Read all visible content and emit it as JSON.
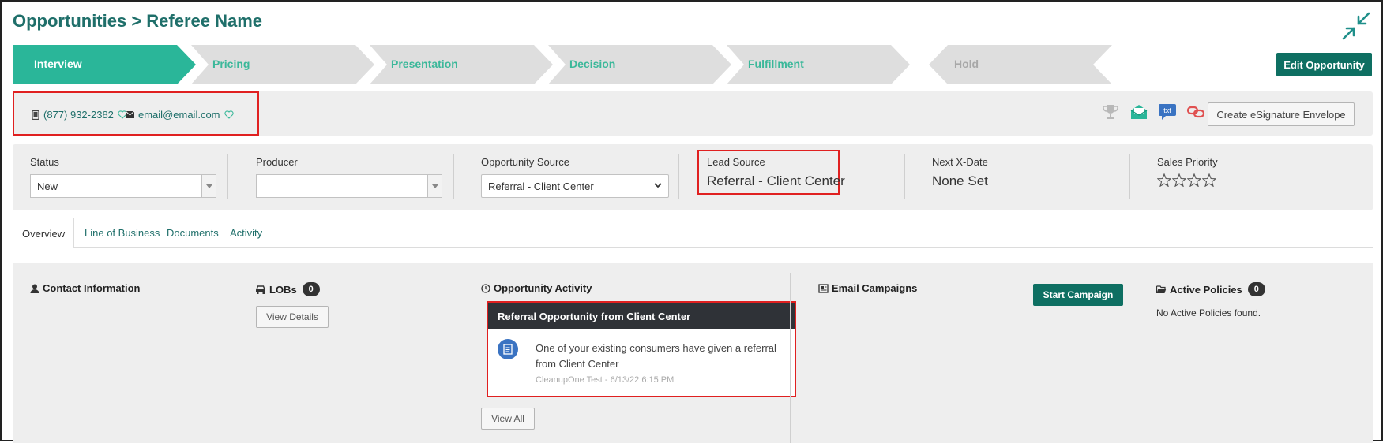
{
  "header": {
    "title": "Opportunities > Referee Name",
    "collapse_icon": "collapse-arrows-icon"
  },
  "stages": [
    {
      "label": "Interview",
      "state": "active"
    },
    {
      "label": "Pricing",
      "state": "pending"
    },
    {
      "label": "Presentation",
      "state": "pending"
    },
    {
      "label": "Decision",
      "state": "pending"
    },
    {
      "label": "Fulfillment",
      "state": "pending"
    },
    {
      "label": "Hold",
      "state": "hold"
    }
  ],
  "edit_button": "Edit Opportunity",
  "contact": {
    "phone": "(877) 932-2382",
    "email": "email@email.com"
  },
  "toolbar": {
    "icons": [
      "trophy-icon",
      "envelope-open-icon",
      "txt-message-icon",
      "link-icon"
    ],
    "esignature_button": "Create eSignature Envelope"
  },
  "status_bar": {
    "status": {
      "label": "Status",
      "value": "New"
    },
    "producer": {
      "label": "Producer",
      "value": ""
    },
    "opportunity_source": {
      "label": "Opportunity Source",
      "value": "Referral - Client Center"
    },
    "lead_source": {
      "label": "Lead Source",
      "value": "Referral - Client Center"
    },
    "next_x_date": {
      "label": "Next X-Date",
      "value": "None Set"
    },
    "sales_priority": {
      "label": "Sales Priority",
      "stars": 0,
      "max_stars": 4
    }
  },
  "tabs": [
    {
      "label": "Overview",
      "active": true
    },
    {
      "label": "Line of Business",
      "active": false
    },
    {
      "label": "Documents",
      "active": false
    },
    {
      "label": "Activity",
      "active": false
    }
  ],
  "panels": {
    "contact_information": {
      "title": "Contact Information"
    },
    "lobs": {
      "title": "LOBs",
      "count": "0",
      "button": "View Details"
    },
    "opportunity_activity": {
      "title": "Opportunity Activity",
      "card_title": "Referral Opportunity from Client Center",
      "card_text": "One of your existing consumers have given a referral from Client Center",
      "card_meta": "CleanupOne Test - 6/13/22 6:15 PM",
      "button": "View All"
    },
    "email_campaigns": {
      "title": "Email Campaigns",
      "button": "Start Campaign"
    },
    "active_policies": {
      "title": "Active Policies",
      "count": "0",
      "empty_text": "No Active Policies found."
    }
  },
  "colors": {
    "brand_teal": "#1f6f6a",
    "stage_active": "#2ab699",
    "stage_pending": "#dedede",
    "button_green": "#0e6f62",
    "highlight_red": "#e02020"
  }
}
